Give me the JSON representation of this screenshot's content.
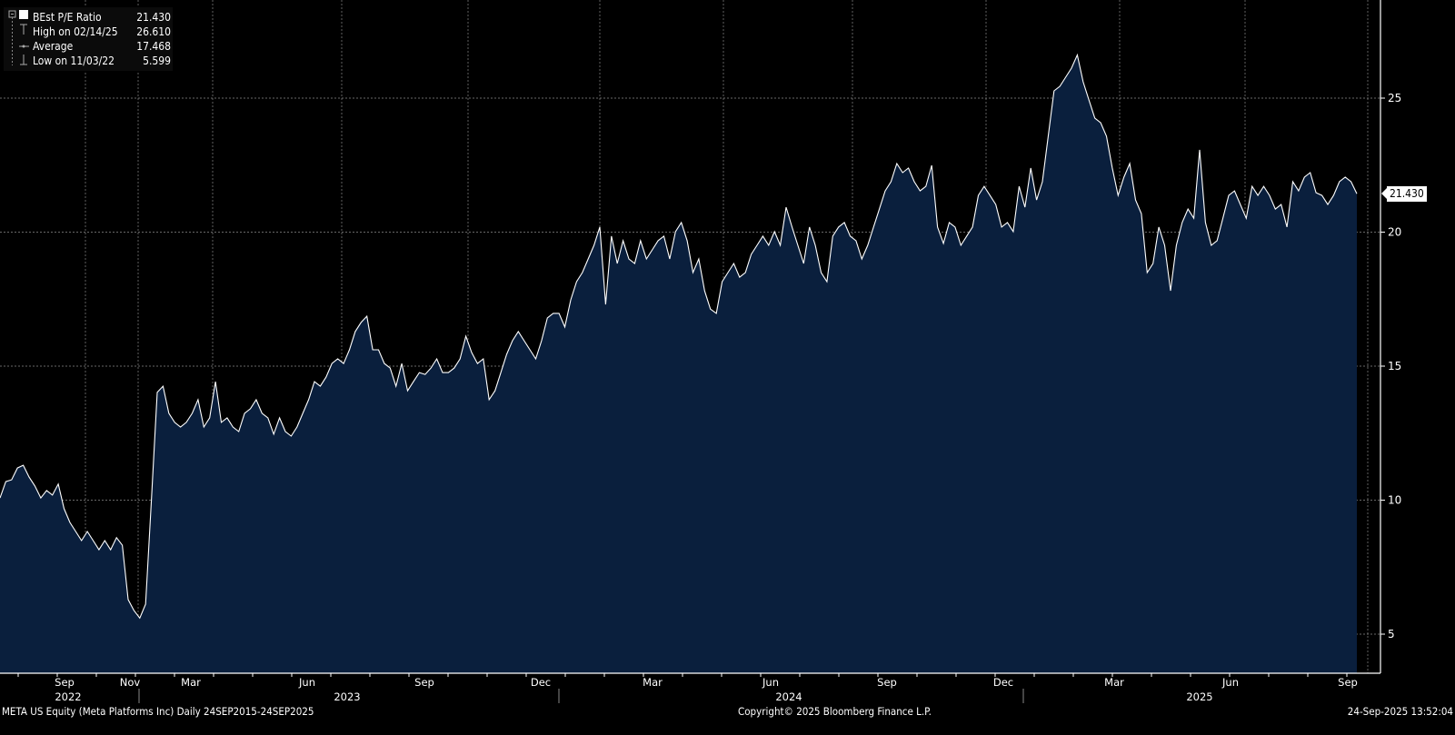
{
  "chart_data": {
    "type": "area",
    "title": "BEst P/E Ratio",
    "xlabel": "",
    "ylabel": "",
    "ylim": [
      3.7,
      28.7
    ],
    "y_ticks": [
      5,
      10,
      15,
      20,
      25
    ],
    "grid": true,
    "legend_position": "top-left",
    "x_month_labels": [
      "Sep",
      "Nov",
      "Mar",
      "Jun",
      "Sep",
      "Dec",
      "Mar",
      "Jun",
      "Sep",
      "Dec",
      "Mar",
      "Jun",
      "Sep"
    ],
    "x_year_labels": [
      "2022",
      "2023",
      "2024",
      "2025"
    ],
    "legend": {
      "series": {
        "label": "BEst P/E Ratio",
        "value": "21.430"
      },
      "high": {
        "label": "High on 02/14/25",
        "value": "26.610"
      },
      "average": {
        "label": "Average",
        "value": "17.468"
      },
      "low": {
        "label": "Low on 11/03/22",
        "value": "5.599"
      }
    },
    "last_value_label": "21.430",
    "colors": {
      "fill": "#0a1f3d",
      "line": "#ffffff",
      "grid": "#8a8a8a"
    },
    "values": [
      10.08,
      10.69,
      10.76,
      11.2,
      11.3,
      10.86,
      10.53,
      10.08,
      10.36,
      10.19,
      10.6,
      9.68,
      9.17,
      8.83,
      8.49,
      8.83,
      8.49,
      8.15,
      8.49,
      8.15,
      8.6,
      8.32,
      6.29,
      5.88,
      5.599,
      6.12,
      10.0,
      14.02,
      14.25,
      13.24,
      12.9,
      12.73,
      12.9,
      13.24,
      13.75,
      12.73,
      13.07,
      14.42,
      12.9,
      13.07,
      12.73,
      12.56,
      13.24,
      13.41,
      13.75,
      13.24,
      13.07,
      12.46,
      13.07,
      12.56,
      12.39,
      12.73,
      13.24,
      13.75,
      14.42,
      14.25,
      14.59,
      15.1,
      15.27,
      15.1,
      15.61,
      16.29,
      16.63,
      16.86,
      15.61,
      15.61,
      15.1,
      14.93,
      14.25,
      15.1,
      14.08,
      14.42,
      14.76,
      14.69,
      14.93,
      15.27,
      14.76,
      14.76,
      14.93,
      15.27,
      16.12,
      15.51,
      15.1,
      15.27,
      13.75,
      14.08,
      14.76,
      15.44,
      15.95,
      16.29,
      15.95,
      15.61,
      15.27,
      15.95,
      16.8,
      16.97,
      16.97,
      16.46,
      17.47,
      18.15,
      18.49,
      19.0,
      19.51,
      20.19,
      17.3,
      19.85,
      18.83,
      19.68,
      19.0,
      18.83,
      19.68,
      19.0,
      19.34,
      19.68,
      19.85,
      19.0,
      20.02,
      20.36,
      19.68,
      18.49,
      19.0,
      17.81,
      17.13,
      16.97,
      18.15,
      18.49,
      18.83,
      18.32,
      18.49,
      19.17,
      19.51,
      19.85,
      19.51,
      20.02,
      19.51,
      20.93,
      20.19,
      19.51,
      18.83,
      20.19,
      19.51,
      18.49,
      18.15,
      19.85,
      20.19,
      20.36,
      19.85,
      19.68,
      19.0,
      19.51,
      20.19,
      20.86,
      21.54,
      21.88,
      22.56,
      22.22,
      22.39,
      21.88,
      21.54,
      21.71,
      22.49,
      20.19,
      19.58,
      20.36,
      20.19,
      19.51,
      19.85,
      20.19,
      21.37,
      21.71,
      21.37,
      21.03,
      20.19,
      20.36,
      20.02,
      21.71,
      20.93,
      22.39,
      21.2,
      21.88,
      23.58,
      25.27,
      25.44,
      25.78,
      26.12,
      26.61,
      25.61,
      24.93,
      24.25,
      24.08,
      23.58,
      22.39,
      21.37,
      22.05,
      22.56,
      21.2,
      20.69,
      18.49,
      18.83,
      20.19,
      19.51,
      17.81,
      19.51,
      20.36,
      20.86,
      20.52,
      23.07,
      20.36,
      19.51,
      19.68,
      20.52,
      21.37,
      21.54,
      21.03,
      20.52,
      21.71,
      21.37,
      21.71,
      21.37,
      20.86,
      21.03,
      20.19,
      21.88,
      21.54,
      22.05,
      22.22,
      21.47,
      21.37,
      21.03,
      21.37,
      21.88,
      22.05,
      21.88,
      21.43
    ]
  },
  "footer": {
    "security": "META US Equity (Meta Platforms Inc)  Daily 24SEP2015-24SEP2025",
    "copyright": "Copyright© 2025 Bloomberg Finance L.P.",
    "timestamp": "24-Sep-2025 13:52:04"
  }
}
